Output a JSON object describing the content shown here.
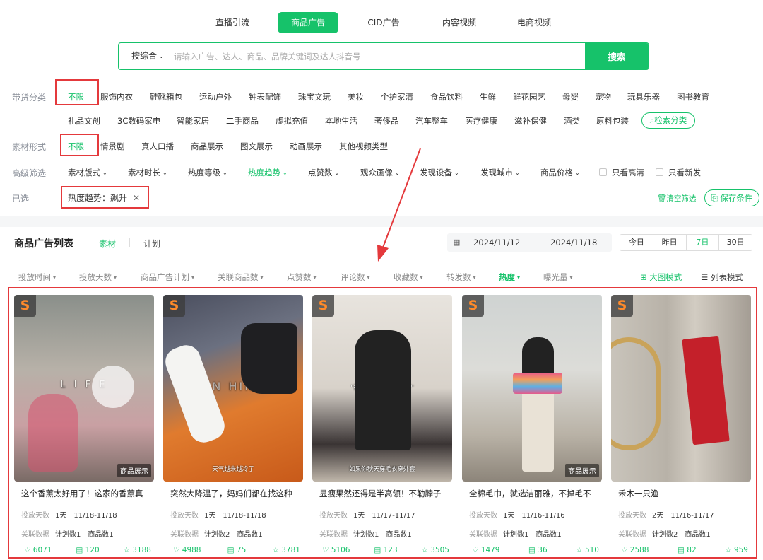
{
  "top_tabs": [
    "直播引流",
    "商品广告",
    "CID广告",
    "内容视频",
    "电商视频"
  ],
  "top_tabs_active": "商品广告",
  "search": {
    "sort_label": "按综合",
    "placeholder": "请输入广告、达人、商品、品牌关键词及达人抖音号",
    "button": "搜索"
  },
  "filters": {
    "category_label": "带货分类",
    "category_row1": [
      "不限",
      "服饰内衣",
      "鞋靴箱包",
      "运动户外",
      "钟表配饰",
      "珠宝文玩",
      "美妆",
      "个护家清",
      "食品饮料",
      "生鲜",
      "鲜花园艺",
      "母婴",
      "宠物",
      "玩具乐器",
      "图书教育"
    ],
    "category_row2": [
      "礼品文创",
      "3C数码家电",
      "智能家居",
      "二手商品",
      "虚拟充值",
      "本地生活",
      "奢侈品",
      "汽车整车",
      "医疗健康",
      "滋补保健",
      "酒类",
      "原料包装"
    ],
    "search_category": "检索分类",
    "material_label": "素材形式",
    "material_items": [
      "不限",
      "情景剧",
      "真人口播",
      "商品展示",
      "图文展示",
      "动画展示",
      "其他视频类型"
    ],
    "advanced_label": "高级筛选",
    "advanced_items": [
      "素材版式",
      "素材时长",
      "热度等级",
      "热度趋势",
      "点赞数",
      "观众画像",
      "发现设备",
      "发现城市",
      "商品价格"
    ],
    "checkbox_hd": "只看高清",
    "checkbox_new": "只看新发",
    "selected_label": "已选",
    "selected_tag": "热度趋势：飙升",
    "clear": "清空筛选",
    "save": "保存条件"
  },
  "list": {
    "title": "商品广告列表",
    "tab_material": "素材",
    "tab_plan": "计划",
    "date_start": "2024/11/12",
    "date_end": "2024/11/18",
    "periods": [
      "今日",
      "昨日",
      "7日",
      "30日"
    ],
    "period_active": "7日",
    "sorts": [
      "投放时间",
      "投放天数",
      "商品广告计划",
      "关联商品数",
      "点赞数",
      "评论数",
      "收藏数",
      "转发数",
      "热度",
      "曝光量"
    ],
    "sort_active": "热度",
    "view_grid": "大图模式",
    "view_list": "列表模式"
  },
  "cards": [
    {
      "title": "这个香薰太好用了！这家的香薰真",
      "days_label": "投放天数",
      "days": "1天",
      "range": "11/18-11/18",
      "rel_label": "关联数据",
      "plans": "计划数1",
      "products": "商品数1",
      "likes": "6071",
      "comments": "120",
      "favs": "3188",
      "tag": "商品展示",
      "caption": ""
    },
    {
      "title": "突然大降温了，妈妈们都在找这种",
      "days_label": "投放天数",
      "days": "1天",
      "range": "11/18-11/18",
      "rel_label": "关联数据",
      "plans": "计划数2",
      "products": "商品数1",
      "likes": "4988",
      "comments": "75",
      "favs": "3781",
      "tag": "",
      "caption": "天气越来越冷了"
    },
    {
      "title": "显瘦果然还得是半高领！不勒脖子",
      "days_label": "投放天数",
      "days": "1天",
      "range": "11/17-11/17",
      "rel_label": "关联数据",
      "plans": "计划数1",
      "products": "商品数1",
      "likes": "5106",
      "comments": "123",
      "favs": "3505",
      "tag": "",
      "caption": "如果你秋天穿毛衣穿外套"
    },
    {
      "title": "全棉毛巾，就选洁丽雅，不掉毛不",
      "days_label": "投放天数",
      "days": "1天",
      "range": "11/16-11/16",
      "rel_label": "关联数据",
      "plans": "计划数1",
      "products": "商品数1",
      "likes": "1479",
      "comments": "36",
      "favs": "510",
      "tag": "商品展示",
      "caption": ""
    },
    {
      "title": "禾木一只渔",
      "days_label": "投放天数",
      "days": "2天",
      "range": "11/16-11/17",
      "rel_label": "关联数据",
      "plans": "计划数2",
      "products": "商品数1",
      "likes": "2588",
      "comments": "82",
      "favs": "959",
      "tag": "",
      "caption": ""
    }
  ],
  "card3_overlay": "\"搭配大衣牛仔裤绝了\"",
  "card1_overlay": "L I F E",
  "card2_overlay": "UN HINE",
  "colors": {
    "accent": "#16c26a",
    "annotation": "#e4393c",
    "badge_s": "#ff8a2a"
  }
}
